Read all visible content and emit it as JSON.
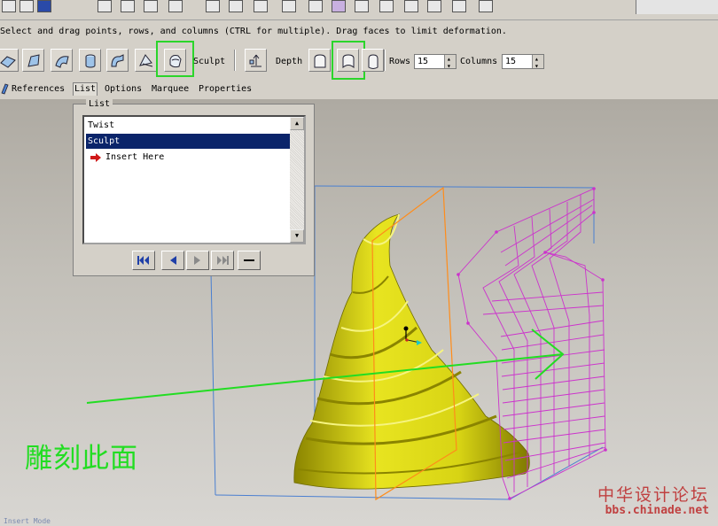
{
  "message": "Select and drag points, rows, and columns (CTRL for multiple). Drag faces to limit deformation.",
  "toolbar": {
    "tool_icons": [
      "surface-icon",
      "extrude-icon",
      "blend-icon",
      "cylinder-icon",
      "sweep-icon",
      "warp-icon",
      "sculpt-icon"
    ],
    "sculpt_label": "Sculpt",
    "depth_label": "Depth",
    "rows_label": "Rows",
    "rows_value": "15",
    "columns_label": "Columns",
    "columns_value": "15"
  },
  "tabs": [
    "References",
    "List",
    "Options",
    "Marquee",
    "Properties"
  ],
  "active_tab": "List",
  "list_panel": {
    "title": "List",
    "items": [
      "Twist",
      "Sculpt",
      "Insert Here"
    ],
    "selected": "Sculpt"
  },
  "annotation": "雕刻此面",
  "status": "Insert Mode",
  "watermark": {
    "line1": "中华设计论坛",
    "line2": "bbs.chinade.net"
  },
  "colors": {
    "model": "#d8d414",
    "lattice": "#cc33cc",
    "bounding_box": "#4a7fd0",
    "plane": "#ff8c1a",
    "highlight": "#2bd52b",
    "selection": "#0a246a"
  }
}
